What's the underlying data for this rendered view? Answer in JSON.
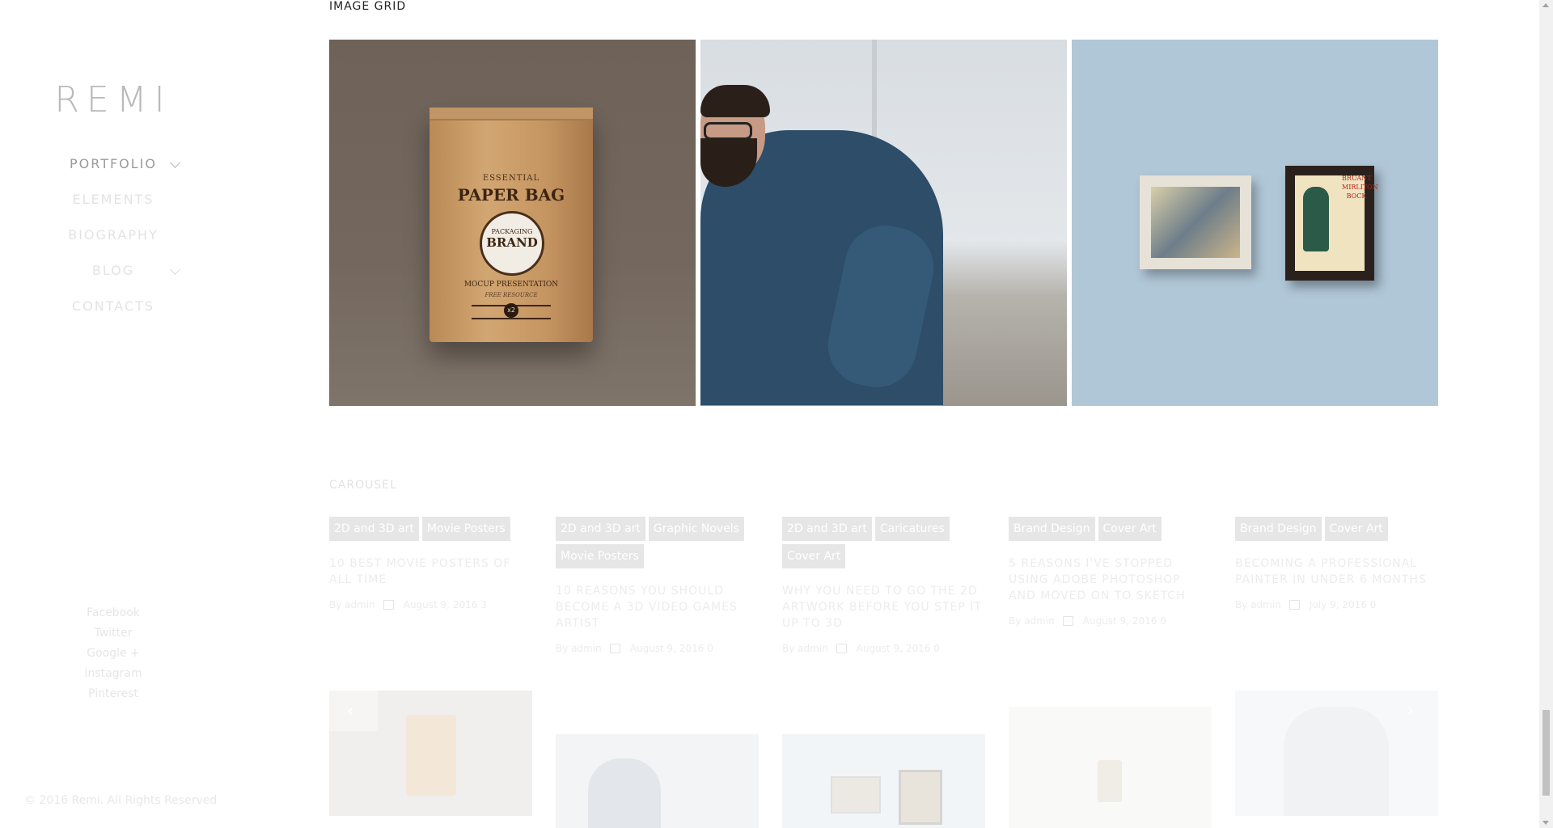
{
  "sidebar": {
    "logo": "REMI",
    "nav": [
      {
        "label": "PORTFOLIO",
        "has_submenu": true,
        "active": true
      },
      {
        "label": "ELEMENTS",
        "has_submenu": false
      },
      {
        "label": "BIOGRAPHY",
        "has_submenu": false
      },
      {
        "label": "BLOG",
        "has_submenu": true
      },
      {
        "label": "CONTACTS",
        "has_submenu": false
      }
    ],
    "social": [
      "Facebook",
      "Twitter",
      "Google +",
      "Instagram",
      "Pinterest"
    ],
    "copyright": "© 2016 Remi. All Rights Reserved"
  },
  "image_grid": {
    "title": "IMAGE GRID",
    "images": [
      {
        "name": "paper-bag-mockup",
        "text": {
          "l1": "ESSENTIAL",
          "l2": "PAPER BAG",
          "l3": "PACKAGING",
          "l4": "BRAND",
          "l5": "MOCUP PRESENTATION",
          "l6": "FREE RESOURCE",
          "l7": "x2"
        }
      },
      {
        "name": "bearded-man-photo"
      },
      {
        "name": "framed-posters",
        "text": {
          "poster": "BRUANT MIRLITON BOCK"
        }
      }
    ]
  },
  "carousel": {
    "title": "CAROUSEL",
    "posts": [
      {
        "tags": [
          "2D and 3D art",
          "Movie Posters"
        ],
        "title": "10 BEST MOVIE POSTERS OF ALL TIME",
        "author": "By admin",
        "date": "August 9, 2016",
        "comments": "3"
      },
      {
        "tags": [
          "2D and 3D art",
          "Graphic Novels",
          "Movie Posters"
        ],
        "title": "10 REASONS YOU SHOULD BECOME A 3D VIDEO GAMES ARTIST",
        "author": "By admin",
        "date": "August 9, 2016",
        "comments": "0"
      },
      {
        "tags": [
          "2D and 3D art",
          "Caricatures",
          "Cover Art"
        ],
        "title": "WHY YOU NEED TO GO THE 2D ARTWORK BEFORE YOU STEP IT UP TO 3D",
        "author": "By admin",
        "date": "August 9, 2016",
        "comments": "0"
      },
      {
        "tags": [
          "Brand Design",
          "Cover Art"
        ],
        "title": "5 REASONS I'VE STOPPED USING ADOBE PHOTOSHOP AND MOVED ON TO SKETCH",
        "author": "By admin",
        "date": "August 9, 2016",
        "comments": "0"
      },
      {
        "tags": [
          "Brand Design",
          "Cover Art"
        ],
        "title": "BECOMING A PROFESSIONAL PAINTER IN UNDER 6 MONTHS",
        "author": "By admin",
        "date": "July 9, 2016",
        "comments": "0"
      }
    ],
    "prev_icon": "chevron-left-icon",
    "next_icon": "chevron-right-icon",
    "prev_glyph": "‹",
    "next_glyph": "›"
  },
  "colors": {
    "accent_text": "#222222",
    "faded_text": "#e3e3e3",
    "tag_bg": "#e6e6e6"
  }
}
